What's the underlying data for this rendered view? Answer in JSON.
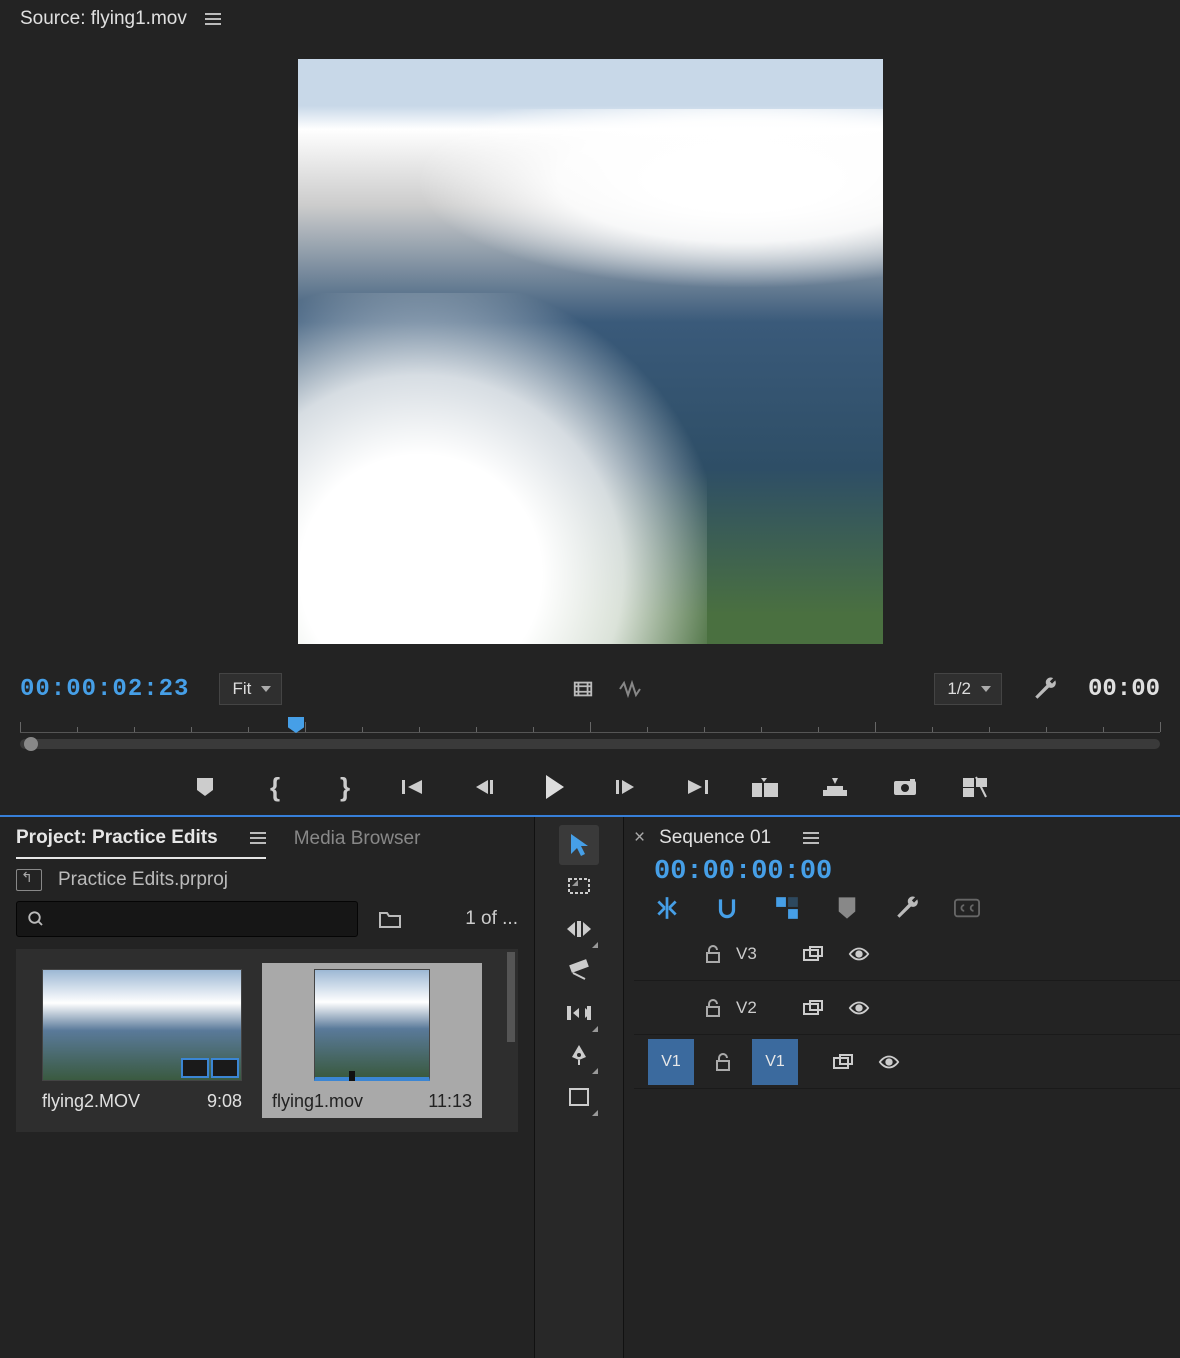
{
  "source": {
    "title": "Source: flying1.mov",
    "timecode_in": "00:00:02:23",
    "zoom": "Fit",
    "resolution": "1/2",
    "timecode_out": "00:00"
  },
  "transport": {
    "mark_in": "{",
    "mark_out": "}"
  },
  "project": {
    "tab_project": "Project: Practice Edits",
    "tab_media": "Media Browser",
    "filename": "Practice Edits.prproj",
    "count": "1 of ...",
    "bins": [
      {
        "name": "flying2.MOV",
        "duration": "9:08"
      },
      {
        "name": "flying1.mov",
        "duration": "11:13"
      }
    ]
  },
  "timeline": {
    "close": "×",
    "name": "Sequence 01",
    "timecode": "00:00:00:00",
    "tracks": {
      "v3": "V3",
      "v2": "V2",
      "v1a": "V1",
      "v1b": "V1"
    }
  }
}
